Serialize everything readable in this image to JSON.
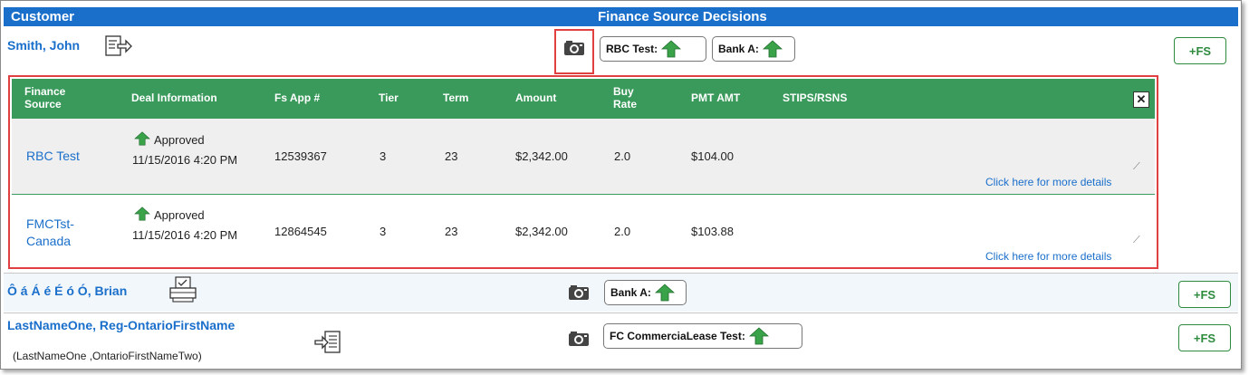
{
  "header": {
    "customer_label": "Customer",
    "decisions_label": "Finance Source Decisions"
  },
  "customers": [
    {
      "name": "Smith, John",
      "decisions": [
        "RBC Test:",
        "Bank A:"
      ],
      "add_label": "+FS"
    },
    {
      "name": "Ô á Á é É ó Ó, Brian",
      "decisions": [
        "Bank A:"
      ],
      "add_label": "+FS"
    },
    {
      "name": "LastNameOne, Reg-OntarioFirstName",
      "subname": "(LastNameOne ,OntarioFirstNameTwo)",
      "decisions": [
        "FC CommerciaLease Test:"
      ],
      "add_label": "+FS"
    }
  ],
  "detail_table": {
    "columns": [
      "Finance Source",
      "Deal Information",
      "Fs App #",
      "Tier",
      "Term",
      "Amount",
      "Buy Rate",
      "PMT AMT",
      "STIPS/RSNS"
    ],
    "close_label": "✕",
    "rows": [
      {
        "finance_source": "RBC Test",
        "status": "Approved",
        "date": "11/15/2016 4:20 PM",
        "app_no": "12539367",
        "tier": "3",
        "term": "23",
        "amount": "$2,342.00",
        "buy_rate": "2.0",
        "pmt_amt": "$104.00",
        "more": "Click here for more details"
      },
      {
        "finance_source": "FMCTst-Canada",
        "status": "Approved",
        "date": "11/15/2016 4:20 PM",
        "app_no": "12864545",
        "tier": "3",
        "term": "23",
        "amount": "$2,342.00",
        "buy_rate": "2.0",
        "pmt_amt": "$103.88",
        "more": "Click here for more details"
      }
    ]
  },
  "colors": {
    "header_blue": "#1a6fcb",
    "table_green": "#3a9a5b",
    "approve_green": "#3aa34a",
    "highlight_red": "#e04040"
  },
  "icons": [
    "send-document-icon",
    "camera-icon",
    "up-arrow-icon",
    "printer-icon",
    "import-document-icon"
  ]
}
